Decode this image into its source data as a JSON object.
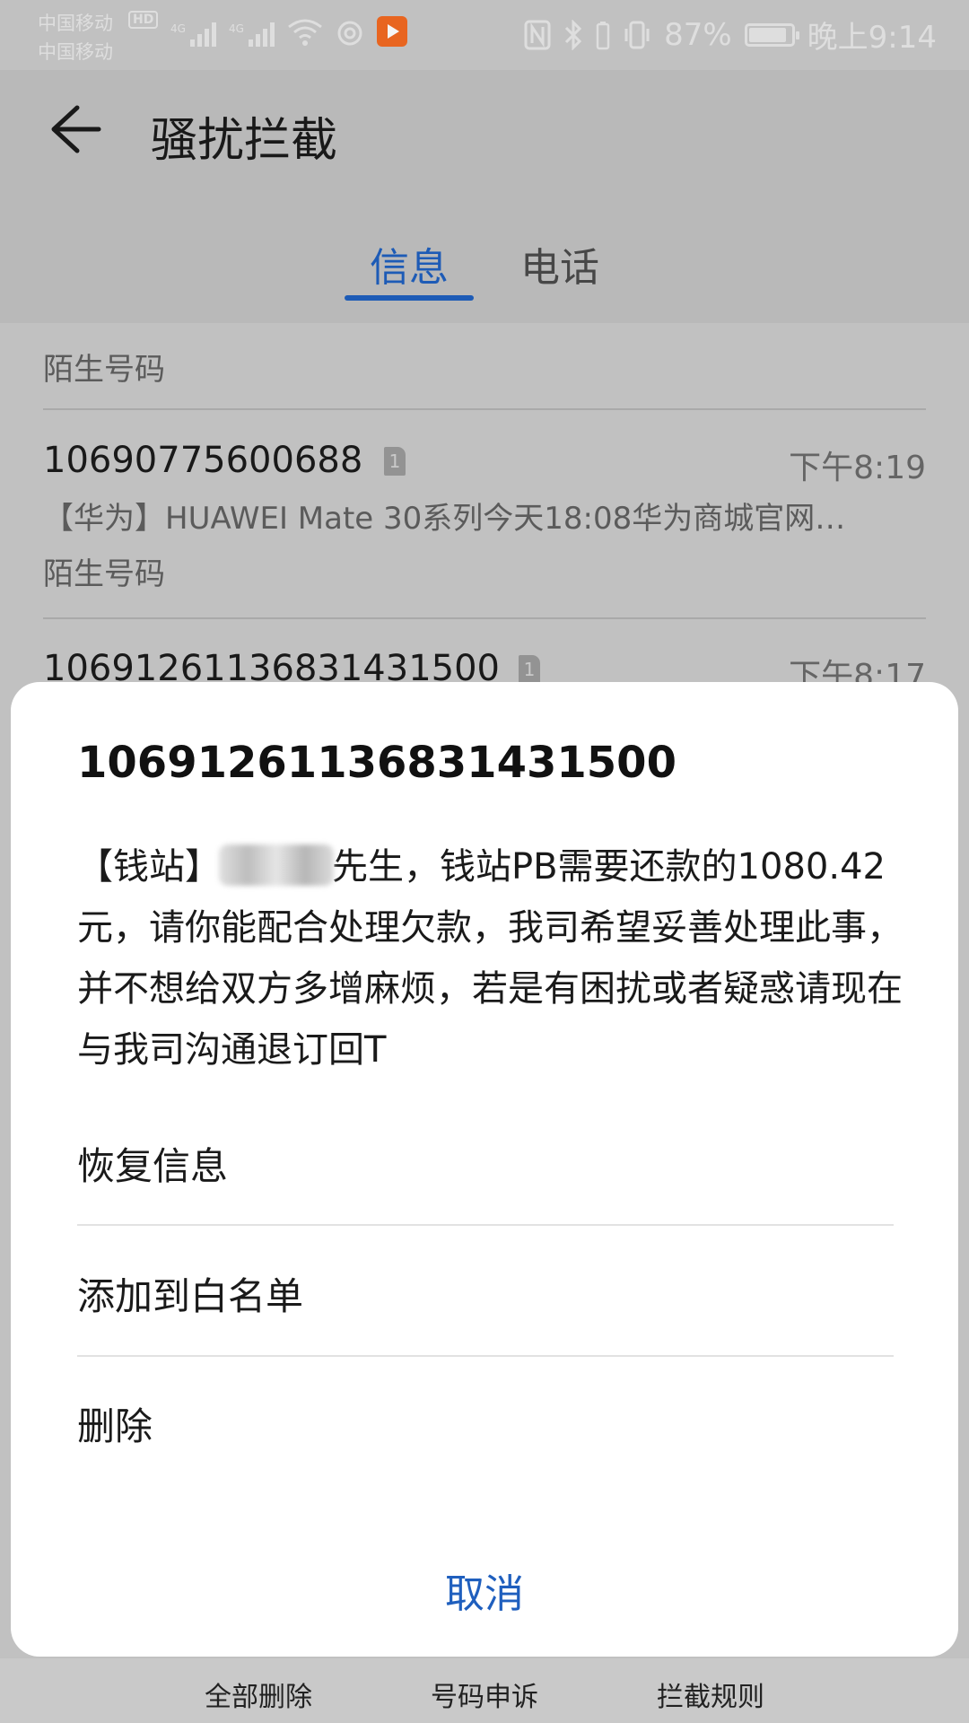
{
  "status_bar": {
    "carrier1": "中国移动",
    "carrier2": "中国移动",
    "hd": "HD",
    "net1": "4G",
    "net2": "4G",
    "battery_percent": "87%",
    "time": "晚上9:14"
  },
  "header": {
    "title": "骚扰拦截",
    "tabs": [
      {
        "label": "信息",
        "active": true
      },
      {
        "label": "电话",
        "active": false
      }
    ]
  },
  "list": {
    "partial_tag": "陌生号码",
    "items": [
      {
        "number": "10690775600688",
        "sim": "1",
        "time": "下午8:19",
        "preview": "【华为】HUAWEI Mate 30系列今天18:08华为商城官网…",
        "tag": "陌生号码"
      },
      {
        "number": "106912611368314315​00",
        "sim": "1",
        "time": "下午8:17"
      }
    ]
  },
  "dialog": {
    "title": "106912611368314315​00",
    "body_prefix": "【钱站】",
    "body_rest": "先生，钱站PB需要还款的1080.42元，请你能配合处理欠款，我司希望妥善处理此事，并不想给双方多增麻烦，若是有困扰或者疑惑请现在与我司沟通退订回T",
    "actions": [
      "恢复信息",
      "添加到白名单",
      "删除"
    ],
    "cancel": "取消"
  },
  "bottom_bar": {
    "items": [
      "全部删除",
      "号码申诉",
      "拦截规则"
    ]
  },
  "colors": {
    "accent": "#1f5fbe",
    "app_badge": "#f26a22"
  }
}
